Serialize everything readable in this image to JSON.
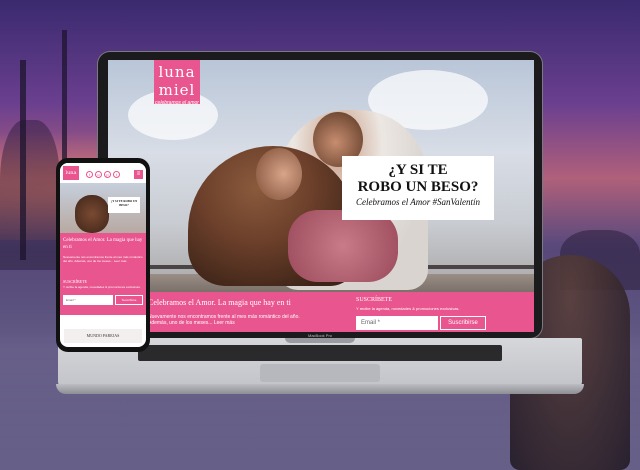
{
  "laptop": {
    "logo": {
      "name": "luna miel",
      "tagline": "celebramos el amor"
    },
    "hero": {
      "headline_line1": "¿Y SI TE",
      "headline_line2": "ROBO UN BESO?",
      "subline": "Celebramos el Amor #SanValentín"
    },
    "intro": {
      "title": "Celebramos el Amor. La magia que hay en ti",
      "text": "Nuevamente nos encontramos frente al mes más romántico del año. Además, uno de los meses... Leer más"
    },
    "newsletter": {
      "title": "SUSCRÍBETE",
      "text": "Y recibe la agenda, novedades & promociones exclusivas.",
      "email_placeholder": "Email *",
      "button_label": "Suscribirse"
    },
    "brand": "MacBook Pro"
  },
  "phone": {
    "logo": "luna miel",
    "social": [
      "f",
      "o",
      "p",
      "t"
    ],
    "menu_icon": "≡",
    "hero_callout": "¿Y SI TE ROBO UN BESO?",
    "intro_title": "Celebramos el Amor. La magia que hay en ti",
    "intro_text": "Nuevamente nos encontramos frente al mes más romántico del año. Además, uno de los meses... Leer más",
    "newsletter_title": "SUSCRÍBETE",
    "newsletter_text": "Y recibe la agenda, novedades & promociones exclusivas.",
    "email_placeholder": "Email *",
    "button_label": "Suscribirse",
    "section_label": "MUNDO PAREJAS"
  },
  "colors": {
    "brand_pink": "#e9558f"
  }
}
